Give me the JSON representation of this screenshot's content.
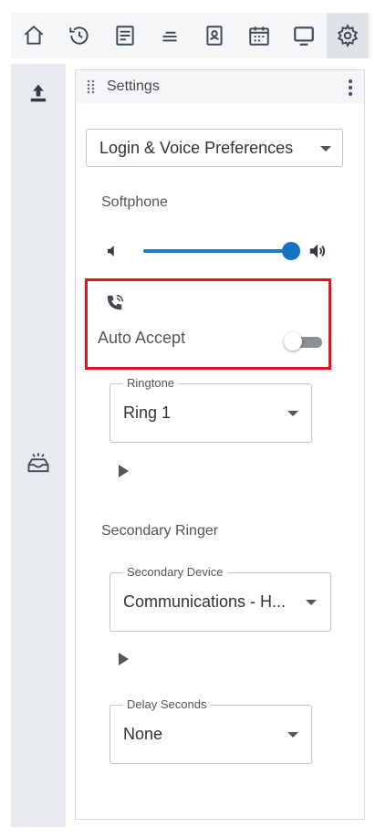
{
  "toolbar": {
    "items": [
      {
        "icon": "home-icon"
      },
      {
        "icon": "history-icon"
      },
      {
        "icon": "notes-icon"
      },
      {
        "icon": "queue-icon"
      },
      {
        "icon": "contacts-icon"
      },
      {
        "icon": "calendar-icon"
      },
      {
        "icon": "monitor-icon"
      },
      {
        "icon": "gear-icon",
        "active": true
      }
    ]
  },
  "sidebar": {
    "icons": [
      "upload-icon",
      "inbox-icon"
    ]
  },
  "panel": {
    "title": "Settings",
    "preference_select": "Login & Voice Preferences",
    "softphone_label": "Softphone",
    "auto_accept_label": "Auto Accept",
    "auto_accept_on": false,
    "volume_level": 1.0,
    "ringtone": {
      "legend": "Ringtone",
      "value": "Ring 1"
    },
    "secondary_ringer_label": "Secondary Ringer",
    "secondary_device": {
      "legend": "Secondary Device",
      "value": "Communications - H..."
    },
    "delay_seconds": {
      "legend": "Delay Seconds",
      "value": "None"
    }
  },
  "colors": {
    "accent": "#1473c2",
    "highlight": "#e0161c"
  }
}
